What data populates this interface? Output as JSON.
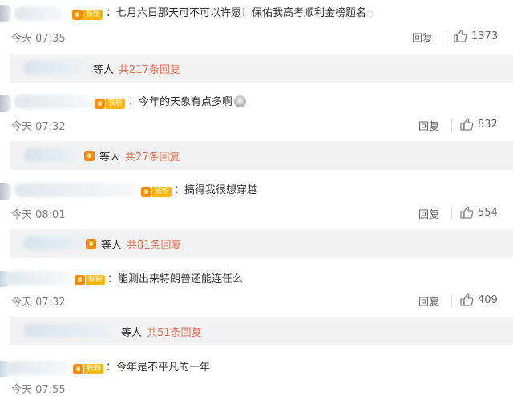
{
  "fan_badge_label": "铁粉",
  "comments": [
    {
      "text": "：七月六日那天可不可以许愿！保佑我高考顺利金榜题名",
      "trailing_mark": "○",
      "time": "今天 07:35",
      "reply_label": "回复",
      "likes": "1373",
      "sub": {
        "others_label": "等人",
        "count_label": "共217条回复"
      }
    },
    {
      "text": "：今年的天象有点多啊",
      "time": "今天 07:32",
      "reply_label": "回复",
      "likes": "832",
      "sub": {
        "others_label": "等人",
        "count_label": "共27条回复"
      }
    },
    {
      "text": "：搞得我很想穿越",
      "time": "今天 08:01",
      "reply_label": "回复",
      "likes": "554",
      "sub": {
        "others_label": "等人",
        "count_label": "共81条回复"
      }
    },
    {
      "text": "：能测出来特朗普还能连任么",
      "time": "今天 07:32",
      "reply_label": "回复",
      "likes": "409",
      "sub": {
        "others_label": "等人",
        "count_label": "共51条回复"
      }
    },
    {
      "text": "：今年是不平凡的一年",
      "time": "今天 07:55"
    }
  ],
  "colors": {
    "link": "#eb7350",
    "badge": "#ffb400",
    "subbox_bg": "#f2f2f5"
  },
  "icons": {
    "like": "thumbs-up-icon",
    "fan": "fan-badge-icon"
  }
}
